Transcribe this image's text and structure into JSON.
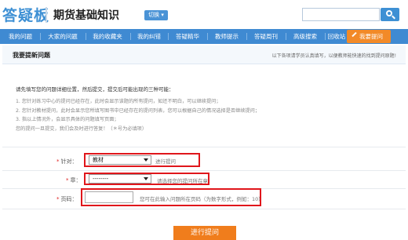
{
  "header": {
    "logo": "答疑板",
    "subject": "期货基础知识",
    "switch_label": "切换",
    "search_placeholder": ""
  },
  "nav": {
    "items": [
      "我的问题",
      "大家的问题",
      "我的收藏夹",
      "我的纠错",
      "答疑精华",
      "教师提示",
      "答疑周刊",
      "高级搜索",
      "回收站"
    ],
    "ask_button": "我要提问"
  },
  "section": {
    "title": "我要提新问题",
    "note": "以下各项请学员认真填写，以便教师能快速的找到提问原题!"
  },
  "instructions": {
    "heading": "请先填写您的问题详细位置，然后提交，提交后可能出现的三种可能：",
    "lines": [
      "1. 您针对练习中心的提问已经存在，此时会显示该题的所有提问，如还不明白，可以继续提问；",
      "2. 您针对教材提问，此时会显示您所填写图书中已经存在的提问列表，您可以根据自己的情况选择是否继续提问；",
      "3. 指以上情况外，会显示具体的问题填写页面；",
      "您的提问一旦提交，我们会及时进行答复！（＊号为必填项）"
    ]
  },
  "form": {
    "row1": {
      "label": "针对：",
      "value": "教材",
      "hint": "进行提问"
    },
    "row2": {
      "label": "章：",
      "value": "--------",
      "hint": "请选择您的提问所在章"
    },
    "row3": {
      "label": "页码：",
      "value": "",
      "hint": "您可在此输入问题所在页码（为数字形式，例如：10）"
    },
    "submit": "进行提问"
  },
  "colors": {
    "brand_blue": "#3f8ad2",
    "ask_orange": "#f28a28",
    "highlight_red": "#e0161b"
  }
}
